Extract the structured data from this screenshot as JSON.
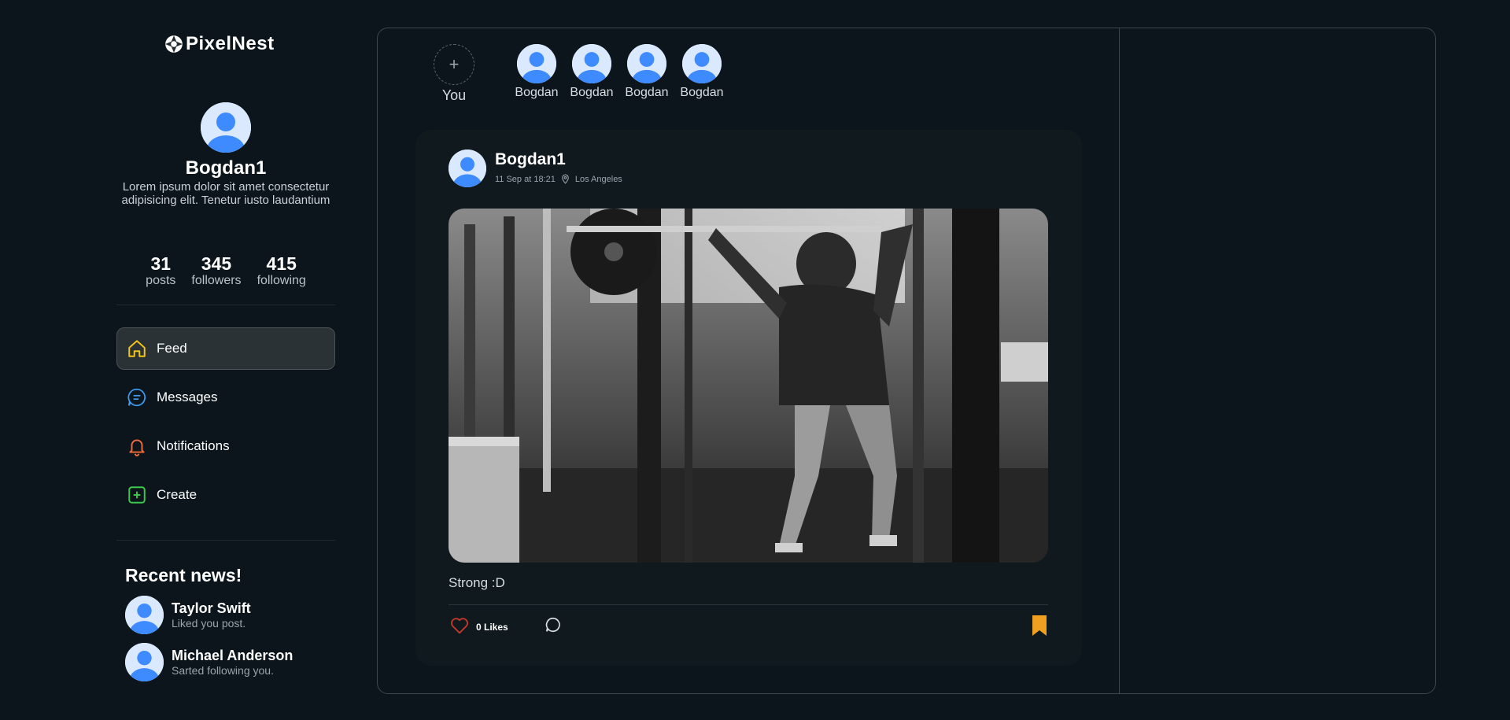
{
  "brand": {
    "name": "PixelNest"
  },
  "profile": {
    "name": "Bogdan1",
    "bio": "Lorem ipsum dolor sit amet consectetur adipisicing elit. Tenetur iusto laudantium",
    "stats": [
      {
        "value": "31",
        "label": "posts"
      },
      {
        "value": "345",
        "label": "followers"
      },
      {
        "value": "415",
        "label": "following"
      }
    ]
  },
  "nav": {
    "items": [
      {
        "label": "Feed",
        "icon": "home-icon",
        "active": true,
        "color": "#f5c518"
      },
      {
        "label": "Messages",
        "icon": "message-icon",
        "active": false,
        "color": "#3b9cf0"
      },
      {
        "label": "Notifications",
        "icon": "bell-icon",
        "active": false,
        "color": "#f26b3a"
      },
      {
        "label": "Create",
        "icon": "plus-square-icon",
        "active": false,
        "color": "#3cc84a"
      }
    ]
  },
  "recent_news": {
    "title": "Recent news!",
    "items": [
      {
        "name": "Taylor Swift",
        "text": "Liked you post."
      },
      {
        "name": "Michael Anderson",
        "text": "Sarted following you."
      }
    ]
  },
  "stories": {
    "add_label": "+",
    "you_label": "You",
    "items": [
      {
        "label": "Bogdan"
      },
      {
        "label": "Bogdan"
      },
      {
        "label": "Bogdan"
      },
      {
        "label": "Bogdan"
      }
    ]
  },
  "post": {
    "author": "Bogdan1",
    "date": "11 Sep at 18:21",
    "location": "Los Angeles",
    "caption": "Strong :D",
    "likes": "0 Likes",
    "image_alt": "black and white gym photo",
    "bookmark_color": "#f0a020",
    "like_color": "#c0392b"
  }
}
